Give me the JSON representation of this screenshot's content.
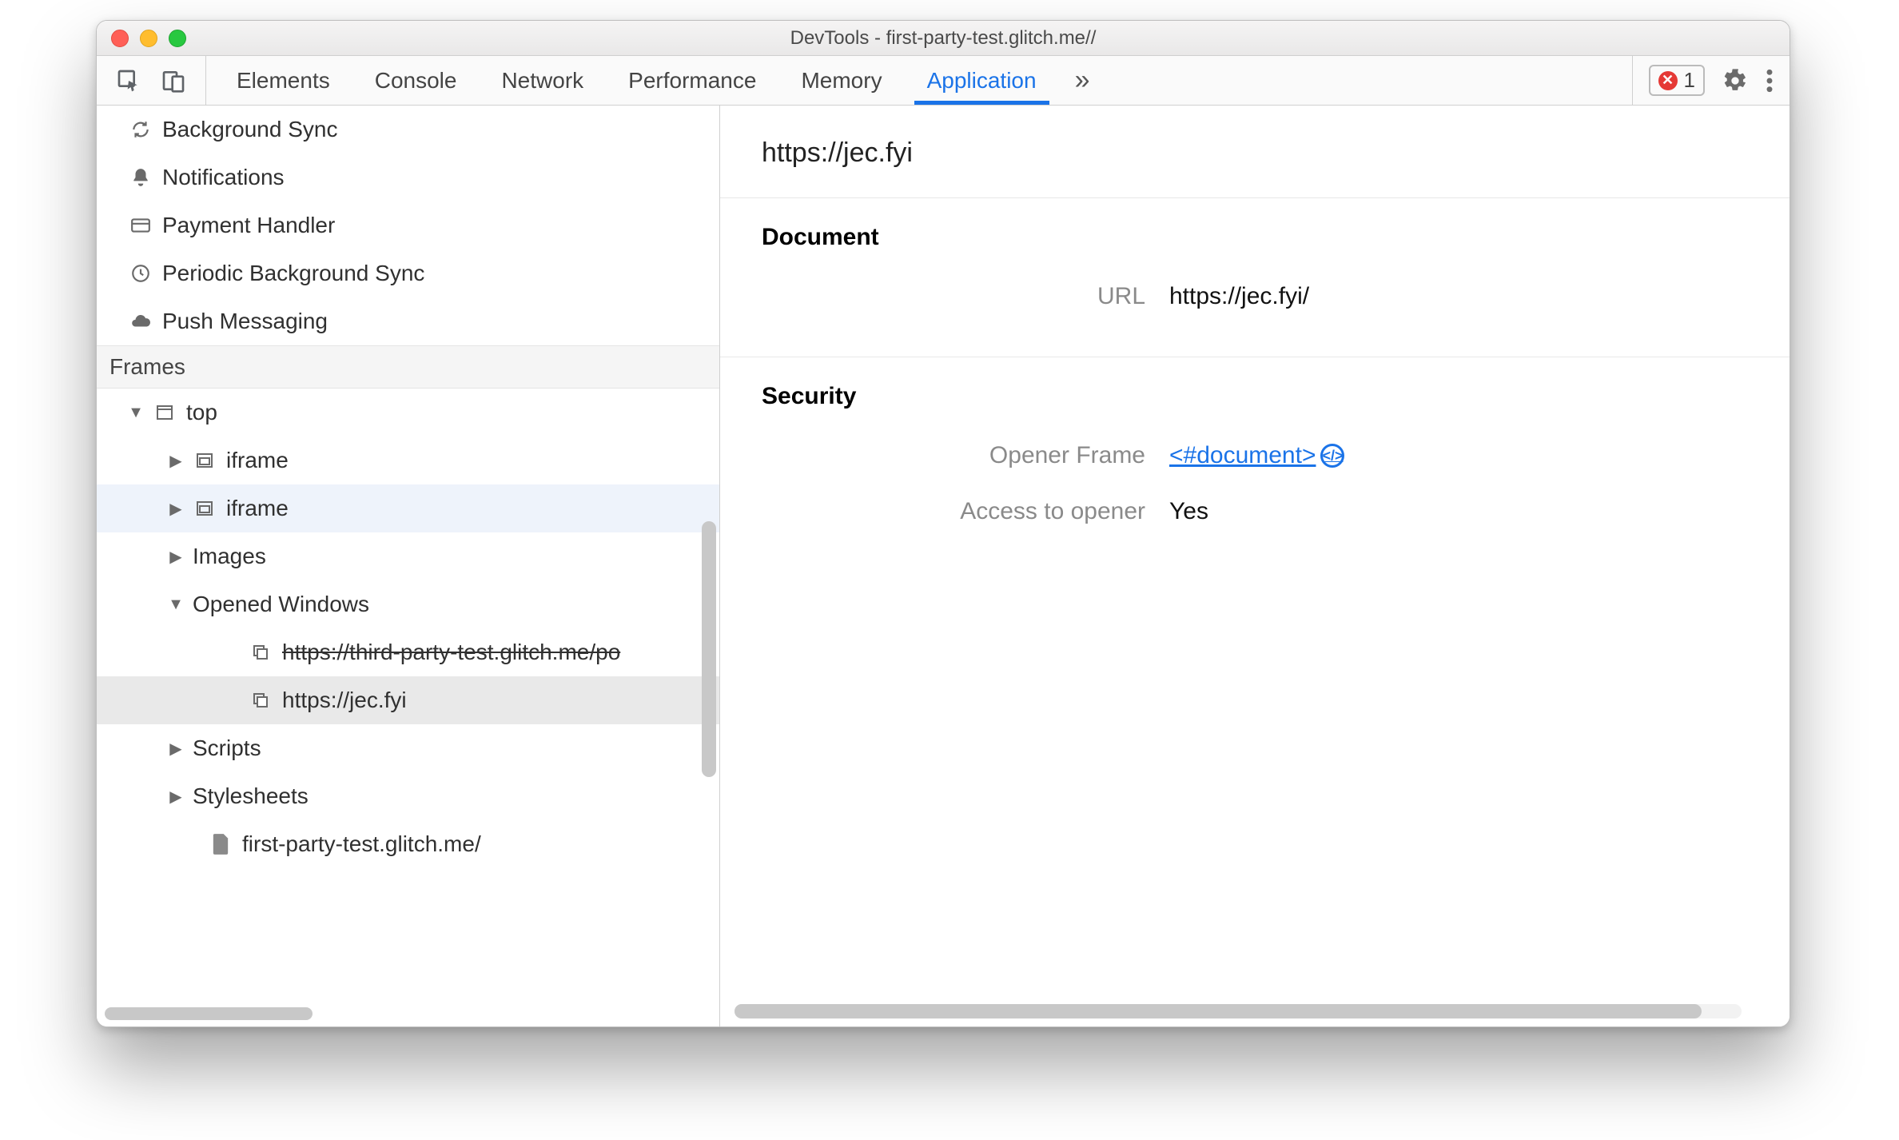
{
  "window": {
    "title": "DevTools - first-party-test.glitch.me//"
  },
  "toolbar": {
    "tabs": [
      "Elements",
      "Console",
      "Network",
      "Performance",
      "Memory",
      "Application"
    ],
    "active_tab_index": 5,
    "more_glyph": "»",
    "error_count": "1"
  },
  "sidebar": {
    "bg_services": [
      {
        "label": "Background Sync",
        "icon": "sync-icon"
      },
      {
        "label": "Notifications",
        "icon": "bell-icon"
      },
      {
        "label": "Payment Handler",
        "icon": "card-icon"
      },
      {
        "label": "Periodic Background Sync",
        "icon": "clock-icon"
      },
      {
        "label": "Push Messaging",
        "icon": "cloud-icon"
      }
    ],
    "frames_category": "Frames",
    "tree": {
      "top_label": "top",
      "iframe1": "iframe",
      "iframe2": "iframe",
      "images": "Images",
      "opened_windows": "Opened Windows",
      "ow_1": "https://third-party-test.glitch.me/po",
      "ow_2": "https://jec.fyi",
      "scripts": "Scripts",
      "stylesheets": "Stylesheets",
      "doc1": "first-party-test.glitch.me/"
    }
  },
  "main": {
    "heading": "https://jec.fyi",
    "document_section": "Document",
    "url_label": "URL",
    "url_value": "https://jec.fyi/",
    "security_section": "Security",
    "opener_label": "Opener Frame",
    "opener_value": "<#document>",
    "access_label": "Access to opener",
    "access_value": "Yes"
  }
}
